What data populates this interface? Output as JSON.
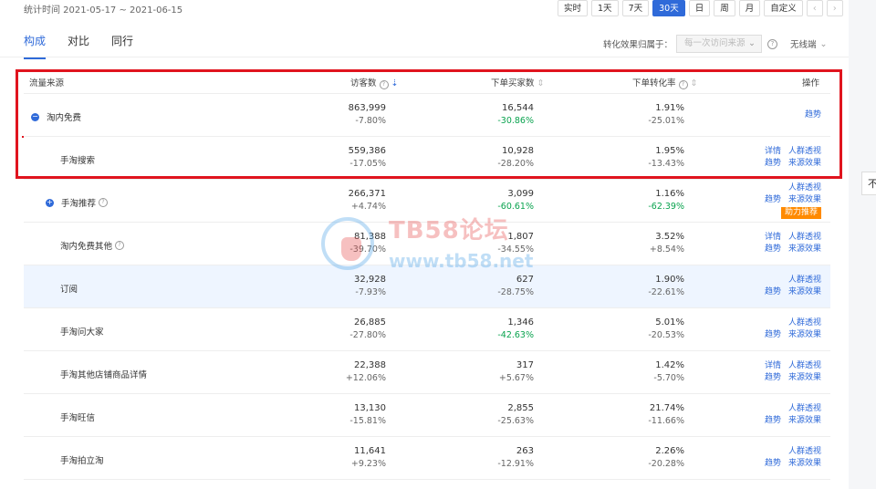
{
  "header": {
    "stat_time": "统计时间 2021-05-17 ~ 2021-06-15",
    "range_buttons": [
      "实时",
      "1天",
      "7天",
      "30天",
      "日",
      "周",
      "月",
      "自定义"
    ],
    "active_range": "30天"
  },
  "tabs": [
    "构成",
    "对比",
    "同行"
  ],
  "controls": {
    "attribution_label": "转化效果归属于：",
    "attribution_placeholder": "每一次访问来源",
    "device": "无线端"
  },
  "table": {
    "headers": {
      "source": "流量来源",
      "visitors": "访客数",
      "buyers": "下单买家数",
      "conversion": "下单转化率",
      "actions": "操作"
    },
    "rows": [
      {
        "name": "淘内免费",
        "expand": true,
        "visitors": "863,999",
        "visitors_change": "-7.80%",
        "buyers": "16,544",
        "buyers_change": "-30.86%",
        "conv": "1.91%",
        "conv_change": "-25.01%",
        "ops": [
          [
            "趋势"
          ]
        ]
      },
      {
        "name": "手淘搜索",
        "visitors": "559,386",
        "visitors_change": "-17.05%",
        "buyers": "10,928",
        "buyers_change": "-28.20%",
        "conv": "1.95%",
        "conv_change": "-13.43%",
        "ops": [
          [
            "详情",
            "人群透视"
          ],
          [
            "趋势",
            "来源效果"
          ]
        ]
      },
      {
        "name": "手淘推荐",
        "expand": true,
        "help": true,
        "visitors": "266,371",
        "visitors_change": "+4.74%",
        "buyers": "3,099",
        "buyers_change": "-60.61%",
        "conv": "1.16%",
        "conv_change": "-62.39%",
        "ops": [
          [
            "人群透视"
          ],
          [
            "趋势",
            "来源效果"
          ]
        ],
        "boost": "助力推荐"
      },
      {
        "name": "淘内免费其他",
        "help": true,
        "visitors": "81,388",
        "visitors_change": "-39.70%",
        "buyers": "1,807",
        "buyers_change": "-34.55%",
        "conv": "3.52%",
        "conv_change": "+8.54%",
        "ops": [
          [
            "详情",
            "人群透视"
          ],
          [
            "趋势",
            "来源效果"
          ]
        ]
      },
      {
        "name": "订阅",
        "highlight": true,
        "visitors": "32,928",
        "visitors_change": "-7.93%",
        "buyers": "627",
        "buyers_change": "-28.75%",
        "conv": "1.90%",
        "conv_change": "-22.61%",
        "ops": [
          [
            "人群透视"
          ],
          [
            "趋势",
            "来源效果"
          ]
        ]
      },
      {
        "name": "手淘问大家",
        "visitors": "26,885",
        "visitors_change": "-27.80%",
        "buyers": "1,346",
        "buyers_change": "-42.63%",
        "conv": "5.01%",
        "conv_change": "-20.53%",
        "ops": [
          [
            "人群透视"
          ],
          [
            "趋势",
            "来源效果"
          ]
        ]
      },
      {
        "name": "手淘其他店铺商品详情",
        "visitors": "22,388",
        "visitors_change": "+12.06%",
        "buyers": "317",
        "buyers_change": "+5.67%",
        "conv": "1.42%",
        "conv_change": "-5.70%",
        "ops": [
          [
            "详情",
            "人群透视"
          ],
          [
            "趋势",
            "来源效果"
          ]
        ]
      },
      {
        "name": "手淘旺信",
        "visitors": "13,130",
        "visitors_change": "-15.81%",
        "buyers": "2,855",
        "buyers_change": "-25.63%",
        "conv": "21.74%",
        "conv_change": "-11.66%",
        "ops": [
          [
            "人群透视"
          ],
          [
            "趋势",
            "来源效果"
          ]
        ]
      },
      {
        "name": "手淘拍立淘",
        "visitors": "11,641",
        "visitors_change": "+9.23%",
        "buyers": "263",
        "buyers_change": "-12.91%",
        "conv": "2.26%",
        "conv_change": "-20.28%",
        "ops": [
          [
            "人群透视"
          ],
          [
            "趋势",
            "来源效果"
          ]
        ]
      }
    ]
  },
  "watermark": {
    "title": "TB58论坛",
    "url": "www.tb58.net"
  },
  "edge_tag": "不",
  "colors": {
    "accent": "#2f6ad9",
    "highlight_box": "#e0141e",
    "green": "#0aa34f",
    "orange": "#ff8a00"
  }
}
